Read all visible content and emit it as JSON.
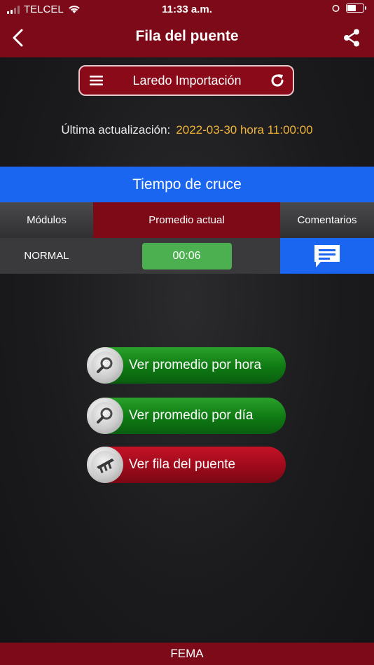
{
  "status_bar": {
    "carrier": "TELCEL",
    "time": "11:33 a.m."
  },
  "header": {
    "title": "Fila del puente",
    "back_icon": "chevron-left-icon",
    "share_icon": "share-icon"
  },
  "location_selector": {
    "label": "Laredo Importación",
    "menu_icon": "hamburger-icon",
    "refresh_icon": "refresh-icon"
  },
  "last_update": {
    "label": "Última actualización:",
    "value": "2022-03-30 hora 11:00:00",
    "value_color": "#f0b43a"
  },
  "crossing": {
    "title": "Tiempo de cruce",
    "columns": [
      "Módulos",
      "Promedio actual",
      "Comentarios"
    ],
    "row": {
      "module": "NORMAL",
      "average": "00:06",
      "comment_icon": "comment-icon"
    }
  },
  "actions": [
    {
      "label": "Ver promedio por hora",
      "icon": "magnifier-icon",
      "color": "green"
    },
    {
      "label": "Ver promedio por día",
      "icon": "magnifier-icon",
      "color": "green"
    },
    {
      "label": "Ver fila del puente",
      "icon": "bridge-icon",
      "color": "red"
    }
  ],
  "footer": {
    "text": "FEMA"
  },
  "colors": {
    "brand": "#7c0a18",
    "accent_blue": "#1a66f0",
    "status_green": "#4cb050"
  }
}
